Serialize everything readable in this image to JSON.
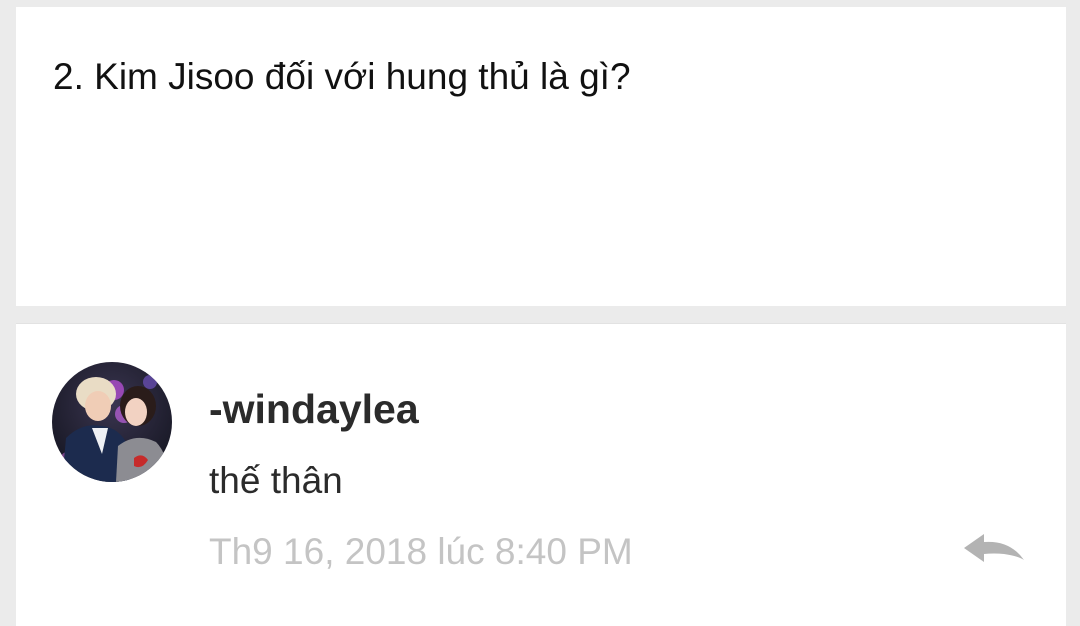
{
  "question": {
    "text": "2. Kim Jisoo đối với hung thủ là gì?"
  },
  "comment": {
    "username": "-windaylea",
    "text": "thế thân",
    "timestamp": "Th9 16, 2018 lúc 8:40 PM",
    "reply_icon": "reply-arrow-icon"
  },
  "colors": {
    "background": "#ebebeb",
    "card": "#ffffff",
    "text": "#2b2b2b",
    "timestamp": "#c4c4c4",
    "reply_icon": "#b3b3b3"
  }
}
